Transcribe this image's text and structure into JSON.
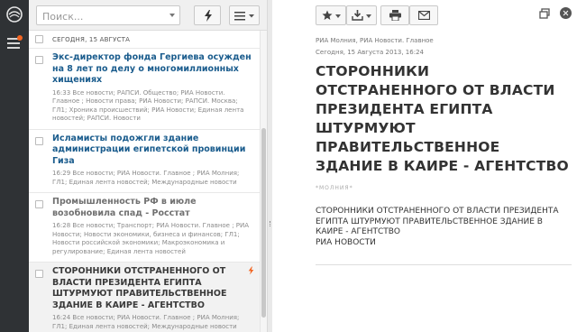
{
  "search": {
    "placeholder": "Поиск..."
  },
  "list": {
    "date_header": "Сегодня, 15 августа",
    "items": [
      {
        "title": "Экс-директор фонда Гергиева осужден на 8 лет по делу о многомиллионных хищениях",
        "meta": "16:33 Все новости; РАПСИ. Общество; РИА Новости. Главное ; Новости права; РИА Новости; РАПСИ. Москва; ГЛ1; Хроника происшествий; РИА Новости; Единая лента новостей; РАПСИ. Новости"
      },
      {
        "title": "Исламисты подожгли здание администрации египетской провинции Гиза",
        "meta": "16:29 Все новости; РИА Новости. Главное ; РИА Молния; ГЛ1; Единая лента новостей; Международные новости"
      },
      {
        "title": "Промышленность РФ в июле возобновила спад - Росстат",
        "meta": "16:28 Все новости; Транспорт; РИА Новости. Главное ; РИА Новости; Новости экономики, бизнеса и финансов; ГЛ1; Новости российской экономики; Макроэкономика и регулирование; Единая лента новостей"
      },
      {
        "title": "СТОРОННИКИ ОТСТРАНЕННОГО ОТ ВЛАСТИ ПРЕЗИДЕНТА ЕГИПТА ШТУРМУЮТ ПРАВИТЕЛЬСТВЕННОЕ ЗДАНИЕ В КАИРЕ - АГЕНТСТВО",
        "meta": "16:24 Все новости; РИА Новости. Главное ; РИА Молния; ГЛ1; Единая лента новостей; Международные новости"
      }
    ]
  },
  "article": {
    "source": "РИА Молния, РИА Новости. Главное",
    "date": "Сегодня, 15 Августа 2013, 16:24",
    "title": "СТОРОННИКИ ОТСТРАНЕННОГО ОТ ВЛАСТИ ПРЕЗИДЕНТА ЕГИПТА ШТУРМУЮТ ПРАВИТЕЛЬСТВЕННОЕ ЗДАНИЕ В КАИРЕ - АГЕНТСТВО",
    "tag": "*МОЛНИЯ*",
    "body": "СТОРОННИКИ ОТСТРАНЕННОГО ОТ ВЛАСТИ ПРЕЗИДЕНТА ЕГИПТА ШТУРМУЮТ ПРАВИТЕЛЬСТВЕННОЕ ЗДАНИЕ В КАИРЕ - АГЕНТСТВО",
    "source_line": "РИА НОВОСТИ"
  },
  "icons": {
    "rail": [
      "ria-logo-icon",
      "menu-icon"
    ],
    "list_toolbar": [
      "flash-icon",
      "list-view-icon"
    ],
    "reader_toolbar": [
      "star-icon",
      "export-icon",
      "print-icon",
      "mail-icon",
      "window-icon",
      "close-icon"
    ]
  },
  "colors": {
    "rail": "#2f3235",
    "link_title": "#1a5c8d",
    "flash_accent": "#f26522",
    "notify_dot": "#f26522"
  }
}
